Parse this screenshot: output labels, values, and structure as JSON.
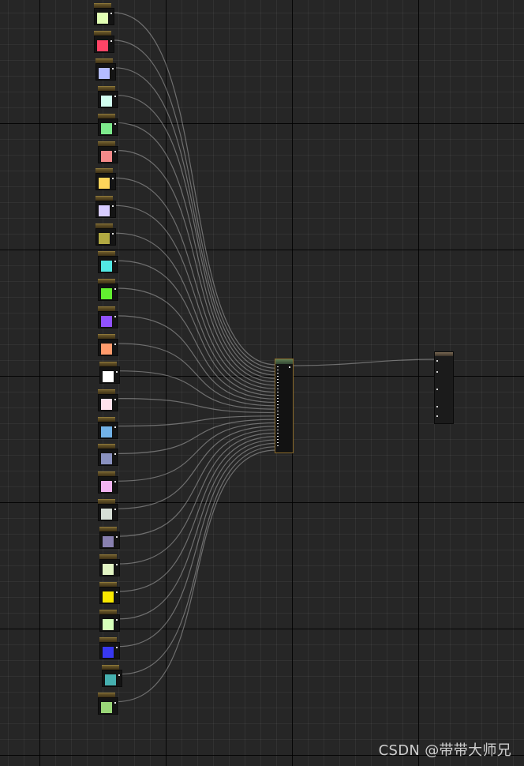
{
  "watermark": "CSDN @带带大师兄",
  "color_nodes": [
    {
      "color": "#e2ffb4"
    },
    {
      "color": "#ff4466"
    },
    {
      "color": "#b4bcff"
    },
    {
      "color": "#d2fff0"
    },
    {
      "color": "#7dea8c"
    },
    {
      "color": "#f58a8a"
    },
    {
      "color": "#ffd45a"
    },
    {
      "color": "#d8ccff"
    },
    {
      "color": "#b2aa42"
    },
    {
      "color": "#52e8e4"
    },
    {
      "color": "#62f030"
    },
    {
      "color": "#9152ff"
    },
    {
      "color": "#ff9b6c"
    },
    {
      "color": "#ffffff"
    },
    {
      "color": "#ffe2ec"
    },
    {
      "color": "#72b2e8"
    },
    {
      "color": "#8a92c0"
    },
    {
      "color": "#f2b4f2"
    },
    {
      "color": "#d6ded6"
    },
    {
      "color": "#8880b0"
    },
    {
      "color": "#e2f4c4"
    },
    {
      "color": "#f8e800"
    },
    {
      "color": "#d6ffba"
    },
    {
      "color": "#3838f0"
    },
    {
      "color": "#46b0b0"
    },
    {
      "color": "#9ad678"
    }
  ]
}
